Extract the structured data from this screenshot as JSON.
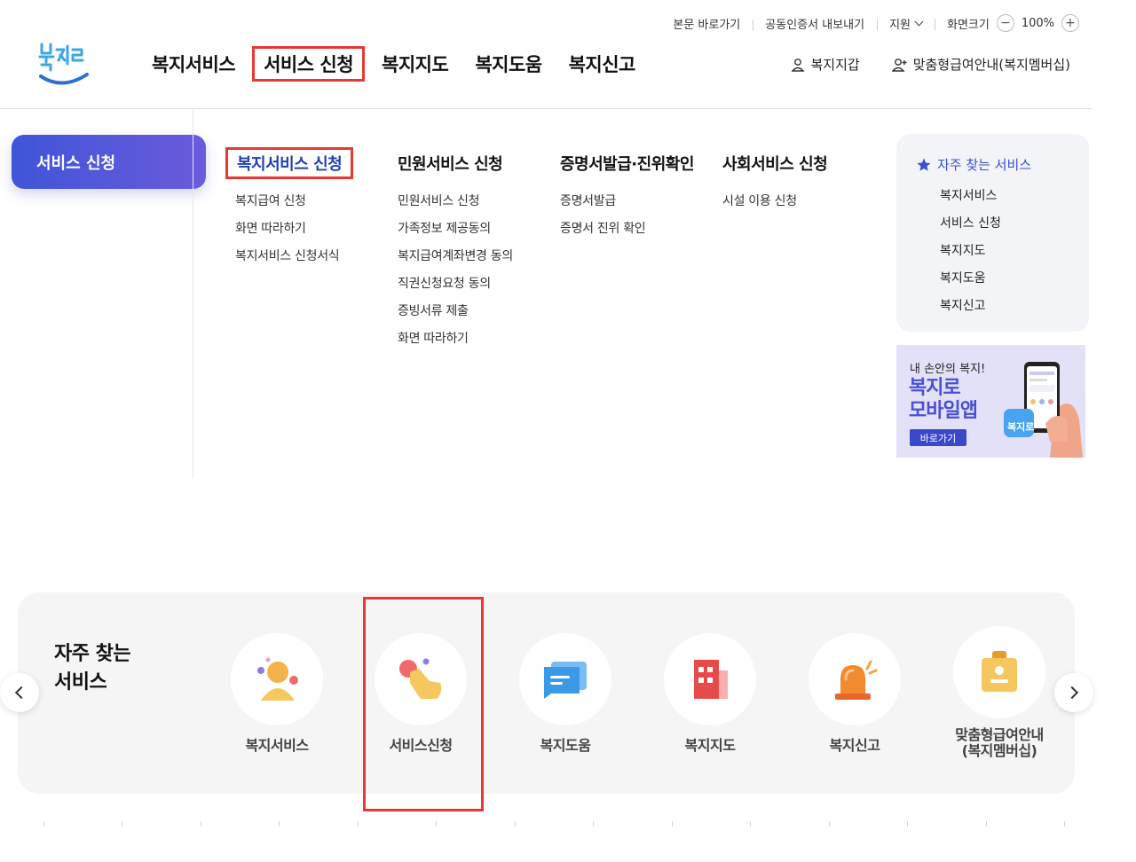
{
  "utility": {
    "skip_to_content": "본문 바로가기",
    "export_certificate": "공동인증서 내보내기",
    "support": "지원",
    "screen_size": "화면크기",
    "zoom_level": "100%",
    "zoom_out": "−",
    "zoom_in": "+"
  },
  "logo": {
    "text": "복지로"
  },
  "gnb": [
    {
      "label": "복지서비스"
    },
    {
      "label": "서비스 신청"
    },
    {
      "label": "복지지도"
    },
    {
      "label": "복지도움"
    },
    {
      "label": "복지신고"
    }
  ],
  "header_right": {
    "my_welfare": "복지지갑",
    "membership": "맞춤형급여안내(복지멤버십)"
  },
  "mega_menu": {
    "title": "서비스 신청",
    "columns": [
      {
        "title": "복지서비스 신청",
        "items": [
          "복지급여 신청",
          "화면 따라하기",
          "복지서비스 신청서식"
        ]
      },
      {
        "title": "민원서비스 신청",
        "items": [
          "민원서비스 신청",
          "가족정보 제공동의",
          "복지급여계좌변경 동의",
          "직권신청요청 동의",
          "증빙서류 제출",
          "화면 따라하기"
        ]
      },
      {
        "title": "증명서발급·진위확인",
        "items": [
          "증명서발급",
          "증명서 진위 확인"
        ]
      },
      {
        "title": "사회서비스 신청",
        "items": [
          "시설 이용 신청"
        ]
      }
    ],
    "favorites": {
      "title": "자주 찾는 서비스",
      "items": [
        "복지서비스",
        "서비스 신청",
        "복지지도",
        "복지도움",
        "복지신고"
      ]
    },
    "banner": {
      "small": "내 손안의 복지!",
      "big_line1": "복지로",
      "big_line2": "모바일앱",
      "button": "바로가기",
      "app_icon": "복지로"
    }
  },
  "frequent_services": {
    "title": "자주 찾는\n서비스",
    "items": [
      {
        "label": "복지서비스",
        "icon": "person-icon"
      },
      {
        "label": "서비스신청",
        "icon": "hand-tap-icon"
      },
      {
        "label": "복지도움",
        "icon": "chat-card-icon"
      },
      {
        "label": "복지지도",
        "icon": "building-icon"
      },
      {
        "label": "복지신고",
        "icon": "siren-icon"
      },
      {
        "label": "맞춤형급여안내\n(복지멤버십)",
        "icon": "id-badge-icon"
      }
    ]
  },
  "colors": {
    "brand_blue": "#3f55d8",
    "highlight_red": "#e53935",
    "banner_purple": "#4b4fd8"
  }
}
